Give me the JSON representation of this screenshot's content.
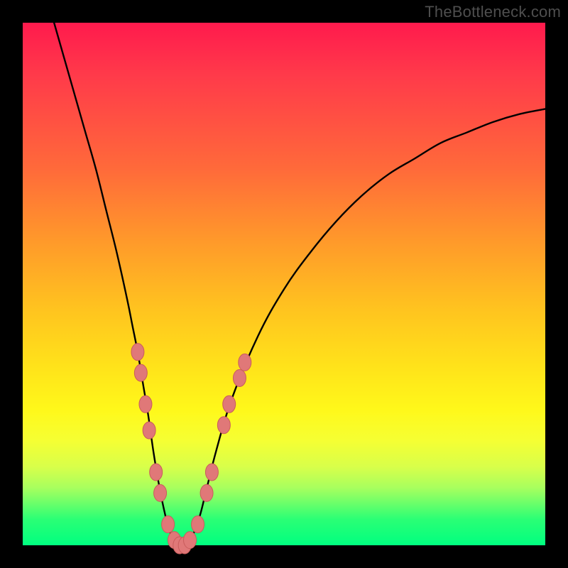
{
  "watermark": "TheBottleneck.com",
  "colors": {
    "frame": "#000000",
    "curve": "#000000",
    "marker_fill": "#e07878",
    "marker_stroke": "#c95c5c",
    "gradient_top": "#ff1a4d",
    "gradient_bottom": "#00ff80"
  },
  "chart_data": {
    "type": "line",
    "title": "",
    "xlabel": "",
    "ylabel": "",
    "xlim": [
      0,
      100
    ],
    "ylim": [
      0,
      100
    ],
    "grid": false,
    "legend": false,
    "series": [
      {
        "name": "bottleneck-curve",
        "x": [
          6,
          8,
          10,
          12,
          14,
          16,
          18,
          20,
          21,
          22,
          23,
          24,
          25,
          26,
          27,
          28,
          29,
          30,
          31,
          32,
          33,
          34,
          35,
          37,
          40,
          45,
          50,
          55,
          60,
          65,
          70,
          75,
          80,
          85,
          90,
          95,
          100
        ],
        "y": [
          100,
          93,
          86,
          79,
          72,
          64,
          56,
          47,
          42,
          37,
          31,
          25,
          18,
          12,
          7,
          3,
          1,
          0,
          0,
          1,
          3,
          6,
          10,
          18,
          28,
          40,
          49,
          56,
          62,
          67,
          71,
          74,
          77,
          79,
          81,
          82.5,
          83.5
        ]
      }
    ],
    "markers": {
      "name": "highlighted-points",
      "points": [
        {
          "x": 22.0,
          "y": 37
        },
        {
          "x": 22.6,
          "y": 33
        },
        {
          "x": 23.5,
          "y": 27
        },
        {
          "x": 24.2,
          "y": 22
        },
        {
          "x": 25.5,
          "y": 14
        },
        {
          "x": 26.3,
          "y": 10
        },
        {
          "x": 27.8,
          "y": 4
        },
        {
          "x": 29.0,
          "y": 1
        },
        {
          "x": 30.0,
          "y": 0
        },
        {
          "x": 31.0,
          "y": 0
        },
        {
          "x": 32.0,
          "y": 1
        },
        {
          "x": 33.5,
          "y": 4
        },
        {
          "x": 35.2,
          "y": 10
        },
        {
          "x": 36.2,
          "y": 14
        },
        {
          "x": 38.5,
          "y": 23
        },
        {
          "x": 39.5,
          "y": 27
        },
        {
          "x": 41.5,
          "y": 32
        },
        {
          "x": 42.5,
          "y": 35
        }
      ]
    }
  }
}
